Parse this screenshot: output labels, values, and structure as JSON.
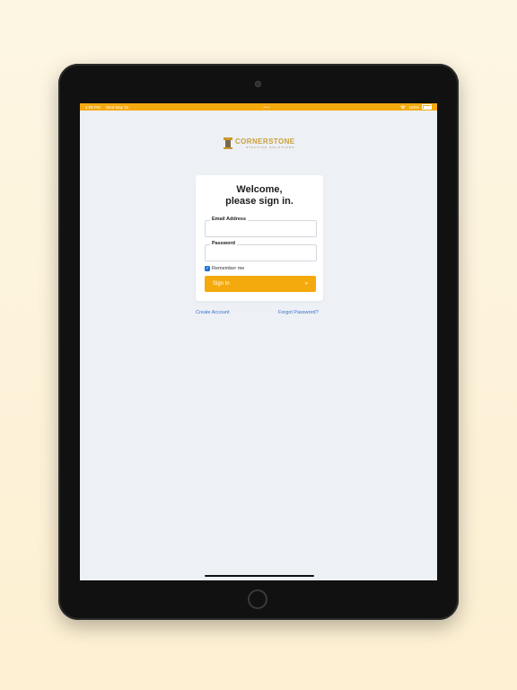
{
  "status_bar": {
    "time": "4:09 PM",
    "date": "Wed May 31",
    "center": "•••",
    "wifi_icon": "wifi-icon",
    "battery_percent": "100%"
  },
  "logo": {
    "name": "CORNERSTONE",
    "tagline": "STAFFING SOLUTIONS"
  },
  "login": {
    "title_line1": "Welcome,",
    "title_line2": "please sign in.",
    "email_label": "Email Address",
    "email_value": "",
    "password_label": "Password",
    "password_value": "",
    "remember_label": "Remember me",
    "remember_checked": true,
    "signin_label": "Sign In",
    "signin_arrow": "»",
    "create_account": "Create Account",
    "forgot_password": "Forgot Password?"
  },
  "colors": {
    "accent": "#f4a90d",
    "link": "#3a73c8",
    "background": "#edf0f5"
  }
}
